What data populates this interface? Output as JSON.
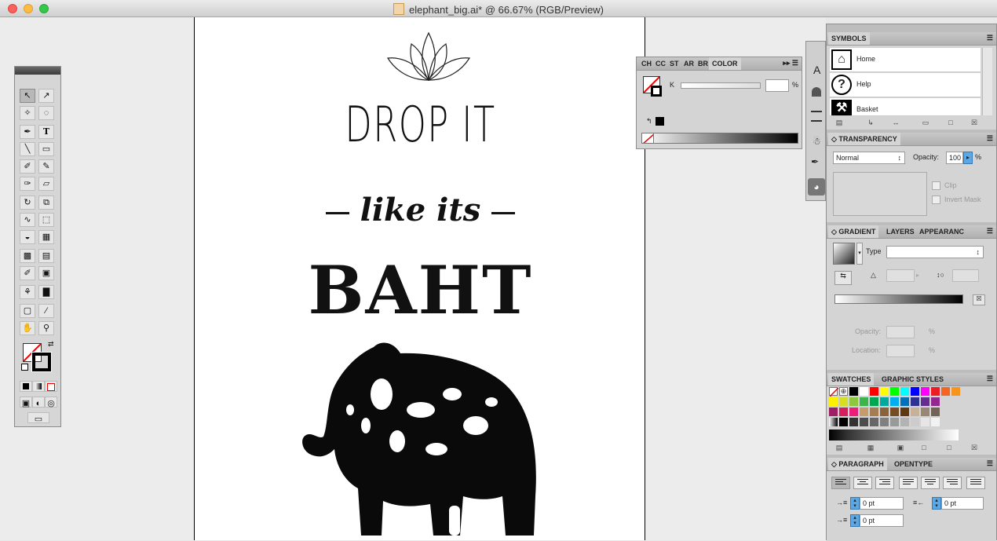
{
  "window": {
    "title": "elephant_big.ai* @ 66.67% (RGB/Preview)"
  },
  "artwork": {
    "line1": "DROP IT",
    "line2": "like its",
    "line3": "BAHT"
  },
  "color_panel": {
    "tabs": [
      "CH",
      "CC",
      "ST",
      "AR",
      "BR"
    ],
    "active_tab": "COLOR",
    "channel_label": "K",
    "percent": "%"
  },
  "stub_panel": {
    "label": "A"
  },
  "symbols_panel": {
    "tab": "SYMBOLS",
    "items": [
      {
        "name": "Home",
        "icon": "house-icon"
      },
      {
        "name": "Help",
        "icon": "question-icon"
      },
      {
        "name": "Basket",
        "icon": "basket-icon"
      }
    ]
  },
  "transparency_panel": {
    "tab": "TRANSPARENCY",
    "blend_mode": "Normal",
    "opacity_label": "Opacity:",
    "opacity_value": "100",
    "percent": "%",
    "clip_label": "Clip",
    "invert_mask_label": "Invert Mask"
  },
  "gradient_panel": {
    "tabs": [
      "GRADIENT",
      "LAYERS",
      "APPEARANC"
    ],
    "type_label": "Type",
    "opacity_label": "Opacity:",
    "location_label": "Location:",
    "percent": "%"
  },
  "swatches_panel": {
    "tabs": [
      "SWATCHES",
      "GRAPHIC STYLES"
    ],
    "row1": [
      "#000000",
      "#ffffff",
      "#ff0000",
      "#ffff00",
      "#00ff00",
      "#00ffff",
      "#0000ff",
      "#ff00ff",
      "#ed1c24",
      "#f26522",
      "#f7941d"
    ],
    "row2": [
      "#fff200",
      "#d7df23",
      "#8dc63f",
      "#39b54a",
      "#00a651",
      "#00a99d",
      "#00aeef",
      "#0072bc",
      "#2e3192",
      "#662d91",
      "#92278f"
    ],
    "row3": [
      "#9e1f63",
      "#d91c5c",
      "#ed1e79",
      "#c69c6d",
      "#a67c52",
      "#8c6239",
      "#754c24",
      "#603913",
      "#c7b299",
      "#998675",
      "#736357"
    ],
    "row4": [
      "#000000",
      "#333333",
      "#4d4d4d",
      "#666666",
      "#808080",
      "#999999",
      "#b3b3b3",
      "#cccccc",
      "#e6e6e6",
      "#f2f2f2"
    ]
  },
  "paragraph_panel": {
    "tabs": [
      "PARAGRAPH",
      "OPENTYPE"
    ],
    "left_indent": "0 pt",
    "right_indent": "0 pt",
    "first_line_indent": "0 pt"
  }
}
